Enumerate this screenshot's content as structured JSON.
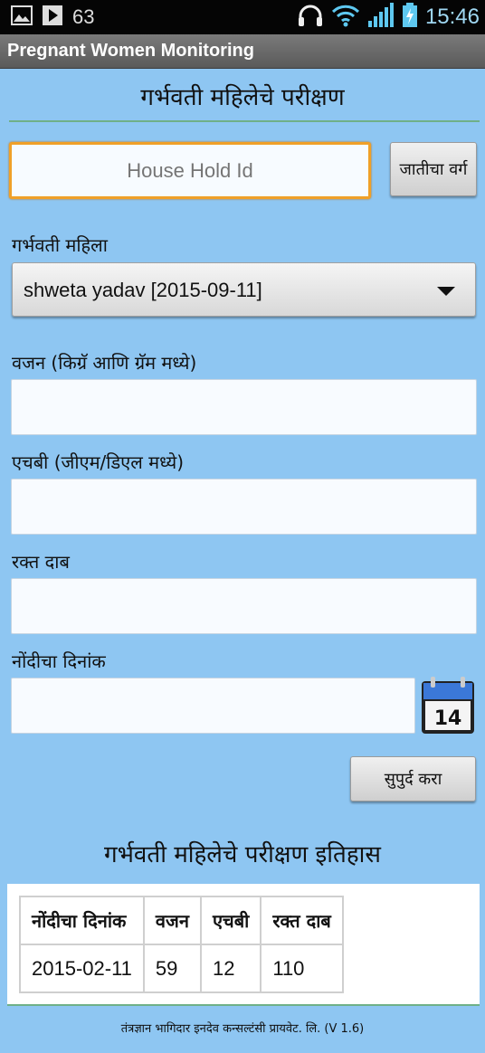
{
  "status_bar": {
    "notification_count": "63",
    "time": "15:46",
    "icons": [
      "image-icon",
      "play-store-icon",
      "headphones-icon",
      "wifi-icon",
      "signal-icon",
      "battery-charging-icon"
    ]
  },
  "app": {
    "title": "Pregnant Women Monitoring"
  },
  "form": {
    "title": "गर्भवती महिलेचे परीक्षण",
    "household_placeholder": "House Hold Id",
    "household_value": "",
    "caste_button": "जातीचा वर्ग",
    "woman_label": "गर्भवती महिला",
    "woman_selected": "shweta yadav [2015-09-11]",
    "weight_label": "वजन (किग्रॅ आणि ग्रॅम मध्ये)",
    "weight_value": "",
    "hb_label": "एचबी (जीएम/डिएल मध्ये)",
    "hb_value": "",
    "bp_label": "रक्त दाब",
    "bp_value": "",
    "date_label": "नोंदीचा दिनांक",
    "date_value": "",
    "calendar_day": "14",
    "submit_button": "सुपुर्द करा"
  },
  "history": {
    "title": "गर्भवती महिलेचे परीक्षण इतिहास",
    "columns": [
      "नोंदीचा दिनांक",
      "वजन",
      "एचबी",
      "रक्त दाब"
    ],
    "rows": [
      [
        "2015-02-11",
        "59",
        "12",
        "110"
      ]
    ]
  },
  "footer": {
    "text": "तंत्रज्ञान भागिदार इनदेव कन्सल्टंसी प्रायवेट. लि. (V 1.6)"
  },
  "colors": {
    "background": "#8ec6f2",
    "focus_border": "#f0a028",
    "divider": "#6fb088",
    "action_bar": "#6a6a6a"
  }
}
